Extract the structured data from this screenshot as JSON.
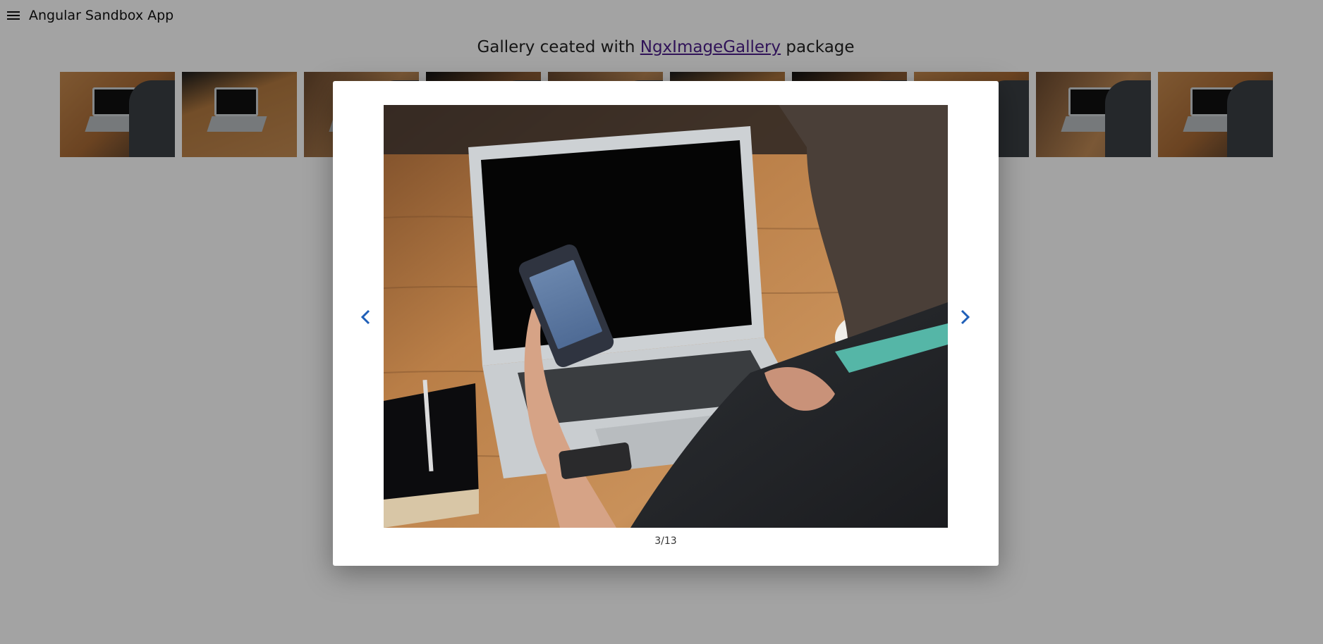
{
  "app": {
    "title": "Angular Sandbox App"
  },
  "heading": {
    "prefix": "Gallery ceated with ",
    "link": "NgxImageGallery",
    "suffix": " package"
  },
  "thumbnails": {
    "count": 10
  },
  "viewer": {
    "counter": "3/13",
    "prev_icon": "chevron-left-icon",
    "next_icon": "chevron-right-icon",
    "accent": "#1f5fb8"
  }
}
